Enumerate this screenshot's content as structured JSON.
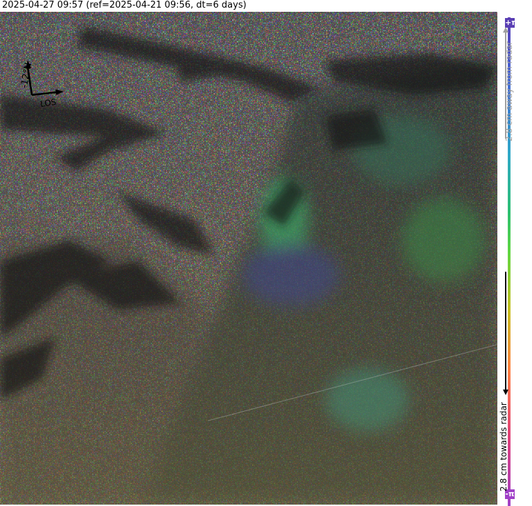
{
  "header": {
    "title": "2025-04-27 09:57 (ref=2025-04-21 09:56, dt=6 days)"
  },
  "compass": {
    "north_label": "-12°N",
    "los_label": "LOS"
  },
  "colorbar": {
    "top_symbol": "+π",
    "bottom_symbol": "-π",
    "away_label": "2.8 cm away from radar",
    "towards_label": "2.8 cm towards radar",
    "colors": [
      "#5a3fb4",
      "#4666d8",
      "#2fa8c8",
      "#2cc070",
      "#5ed640",
      "#c8c020",
      "#ff8040",
      "#e0407a",
      "#a040c8"
    ]
  },
  "image": {
    "description_icon": "interferogram-image"
  }
}
